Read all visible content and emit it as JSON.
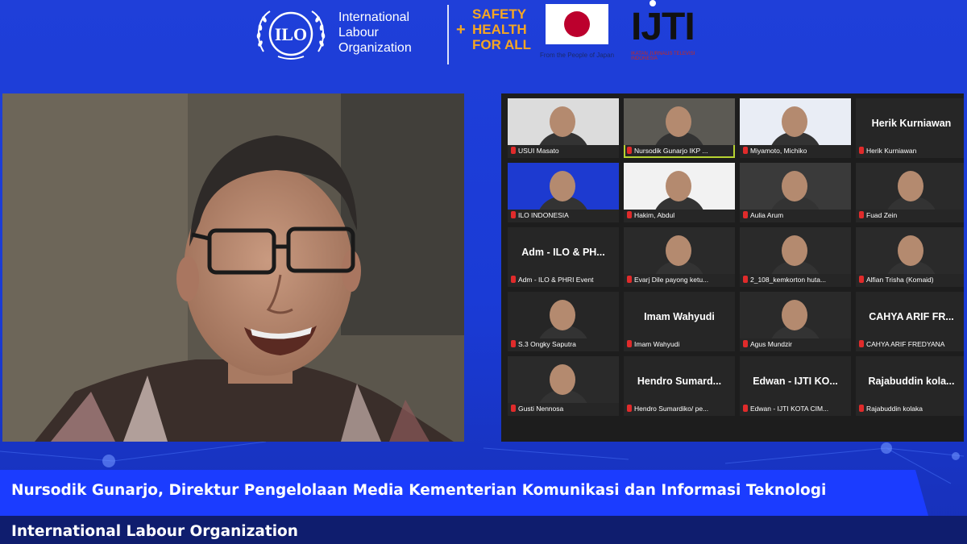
{
  "header": {
    "ilo_lines": [
      "International",
      "Labour",
      "Organization"
    ],
    "ilo_emblem_text": "ILO",
    "safety_lines": [
      "SAFETY",
      "HEALTH",
      "FOR ALL"
    ],
    "safety_plus": "+",
    "japan_caption": "From the People of Japan",
    "iuti_text": "IJTI",
    "iuti_sub": "IKATAN JURNALIS TELEVISI INDONESIA"
  },
  "speaker": {
    "name": "Nursodik Gunarjo"
  },
  "gallery": {
    "tiles": [
      {
        "kind": "video",
        "label": "USUI Masato",
        "bg": "#dcdcdc"
      },
      {
        "kind": "video",
        "label": "Nursodik Gunarjo IKP ...",
        "bg": "#5c5a54",
        "active": true
      },
      {
        "kind": "video",
        "label": "Miyamoto, Michiko",
        "bg": "#e9edf5"
      },
      {
        "kind": "name",
        "title": "Herik Kurniawan",
        "label": "Herik Kurniawan"
      },
      {
        "kind": "video",
        "label": "ILO INDONESIA",
        "bg": "#1d3ad0"
      },
      {
        "kind": "video",
        "label": "Hakim, Abdul",
        "bg": "#f2f2f2"
      },
      {
        "kind": "video",
        "label": "Aulia Arum",
        "bg": "#3a3a3a"
      },
      {
        "kind": "video",
        "label": "Fuad Zein",
        "bg": "#2a2a2a"
      },
      {
        "kind": "name",
        "title": "Adm - ILO & PH...",
        "label": "Adm - ILO & PHRI Event"
      },
      {
        "kind": "video",
        "label": "Evarj Dile payong ketu...",
        "bg": "#2a2a2a"
      },
      {
        "kind": "video",
        "label": "2_108_kemkorton huta...",
        "bg": "#2a2a2a"
      },
      {
        "kind": "video",
        "label": "Alfian Trisha (Komaid)",
        "bg": "#2a2a2a"
      },
      {
        "kind": "video",
        "label": "S.3 Ongky Saputra",
        "bg": "#262626"
      },
      {
        "kind": "name",
        "title": "Imam Wahyudi",
        "label": "Imam Wahyudi"
      },
      {
        "kind": "video",
        "label": "Agus Mundzir",
        "bg": "#2a2a2a"
      },
      {
        "kind": "name",
        "title": "CAHYA ARIF FR...",
        "label": "CAHYA ARIF FREDYANA"
      },
      {
        "kind": "video",
        "label": "Gusti Nennosa",
        "bg": "#2a2a2a"
      },
      {
        "kind": "name",
        "title": "Hendro Sumard...",
        "label": "Hendro Sumardiko/ pe..."
      },
      {
        "kind": "name",
        "title": "Edwan - IJTI KO...",
        "label": "Edwan - IJTI KOTA CIM..."
      },
      {
        "kind": "name",
        "title": "Rajabuddin kola...",
        "label": "Rajabuddin kolaka"
      }
    ]
  },
  "lower_third": {
    "caption": "Nursodik Gunarjo, Direktur Pengelolaan Media Kementerian Komunikasi dan Informasi Teknologi",
    "org": "International Labour Organization"
  }
}
